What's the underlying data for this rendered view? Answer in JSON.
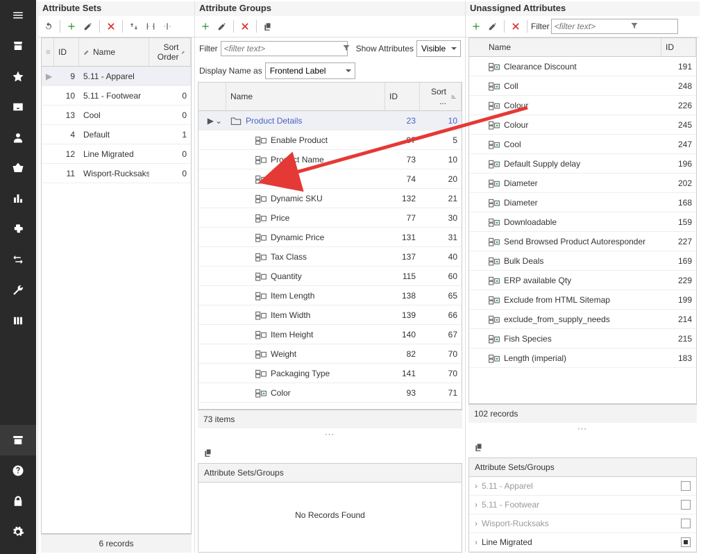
{
  "panels": {
    "sets": {
      "title": "Attribute Sets",
      "headers": {
        "id": "ID",
        "name": "Name",
        "sort": "Sort Order"
      },
      "rows": [
        {
          "id": 9,
          "name": "5.11 - Apparel",
          "sort": ""
        },
        {
          "id": 10,
          "name": "5.11 - Footwear",
          "sort": 0
        },
        {
          "id": 13,
          "name": "Cool",
          "sort": 0
        },
        {
          "id": 4,
          "name": "Default",
          "sort": 1
        },
        {
          "id": 12,
          "name": "Line Migrated",
          "sort": 0
        },
        {
          "id": 11,
          "name": "Wisport-Rucksaks",
          "sort": 0
        }
      ],
      "footer": "6 records"
    },
    "groups": {
      "title": "Attribute Groups",
      "filter_label": "Filter",
      "filter_placeholder": "<filter text>",
      "show_attr_label": "Show Attributes",
      "show_attr_value": "Visible",
      "display_as_label": "Display Name as",
      "display_as_value": "Frontend Label",
      "headers": {
        "name": "Name",
        "id": "ID",
        "sort": "Sort ..."
      },
      "group_row": {
        "name": "Product Details",
        "id": 23,
        "sort": 10
      },
      "rows": [
        {
          "name": "Enable Product",
          "id": 97,
          "sort": 5,
          "star": false
        },
        {
          "name": "Product Name",
          "id": 73,
          "sort": 10,
          "star": false
        },
        {
          "name": "SKU",
          "id": 74,
          "sort": 20,
          "star": false
        },
        {
          "name": "Dynamic SKU",
          "id": 132,
          "sort": 21,
          "star": false
        },
        {
          "name": "Price",
          "id": 77,
          "sort": 30,
          "star": false
        },
        {
          "name": "Dynamic Price",
          "id": 131,
          "sort": 31,
          "star": false
        },
        {
          "name": "Tax Class",
          "id": 137,
          "sort": 40,
          "star": false
        },
        {
          "name": "Quantity",
          "id": 115,
          "sort": 60,
          "star": false
        },
        {
          "name": "Item Length",
          "id": 138,
          "sort": 65,
          "star": false
        },
        {
          "name": "Item Width",
          "id": 139,
          "sort": 66,
          "star": false
        },
        {
          "name": "Item Height",
          "id": 140,
          "sort": 67,
          "star": false
        },
        {
          "name": "Weight",
          "id": 82,
          "sort": 70,
          "star": false
        },
        {
          "name": "Packaging Type",
          "id": 141,
          "sort": 70,
          "star": false
        },
        {
          "name": "Color",
          "id": 93,
          "sort": 71,
          "star": true
        }
      ],
      "footer": "73 items",
      "sub_title": "Attribute Sets/Groups",
      "sub_empty": "No Records Found"
    },
    "unassigned": {
      "title": "Unassigned Attributes",
      "filter_placeholder": "<filter text>",
      "headers": {
        "name": "Name",
        "id": "ID"
      },
      "rows": [
        {
          "name": "Clearance Discount",
          "id": 191
        },
        {
          "name": "Coll",
          "id": 248
        },
        {
          "name": "Colour",
          "id": 226
        },
        {
          "name": "Colour",
          "id": 245
        },
        {
          "name": "Cool",
          "id": 247
        },
        {
          "name": "Default Supply delay",
          "id": 196
        },
        {
          "name": "Diameter",
          "id": 202
        },
        {
          "name": "Diameter",
          "id": 168
        },
        {
          "name": "Downloadable",
          "id": 159
        },
        {
          "name": "Send Browsed Product Autoresponder",
          "id": 227
        },
        {
          "name": "Bulk Deals",
          "id": 169
        },
        {
          "name": "ERP available Qty",
          "id": 229
        },
        {
          "name": "Exclude from HTML Sitemap",
          "id": 199
        },
        {
          "name": "exclude_from_supply_needs",
          "id": 214
        },
        {
          "name": "Fish Species",
          "id": 215
        },
        {
          "name": "Length (imperial)",
          "id": 183
        }
      ],
      "footer": "102 records",
      "sub_title": "Attribute Sets/Groups",
      "sub_rows": [
        {
          "name": "5.11 - Apparel",
          "dim": true,
          "semi": false
        },
        {
          "name": "5.11 - Footwear",
          "dim": true,
          "semi": false
        },
        {
          "name": "Wisport-Rucksaks",
          "dim": true,
          "semi": false
        },
        {
          "name": "Line Migrated",
          "dim": false,
          "semi": true
        }
      ]
    }
  }
}
